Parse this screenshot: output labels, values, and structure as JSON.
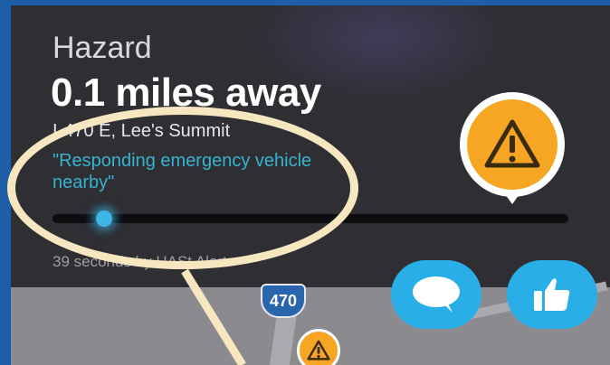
{
  "alert": {
    "title": "Hazard",
    "distance": "0.1 miles away",
    "address": "I-470 E, Lee's Summit",
    "message": "\"Responding emergency vehicle nearby\"",
    "source": "39 seconds by HASt Alert",
    "progress_fraction": 0.1
  },
  "map": {
    "highway_shield": "470"
  },
  "icons": {
    "hazard": "warning-triangle-icon",
    "comment": "speech-bubble-icon",
    "thumbs_up": "thumbs-up-icon"
  },
  "colors": {
    "panel": "#2e2e33",
    "hazard_orange": "#f6a623",
    "button_blue": "#2aaee8",
    "message_teal": "#35b5cf",
    "highlight": "#f7e7c0"
  }
}
